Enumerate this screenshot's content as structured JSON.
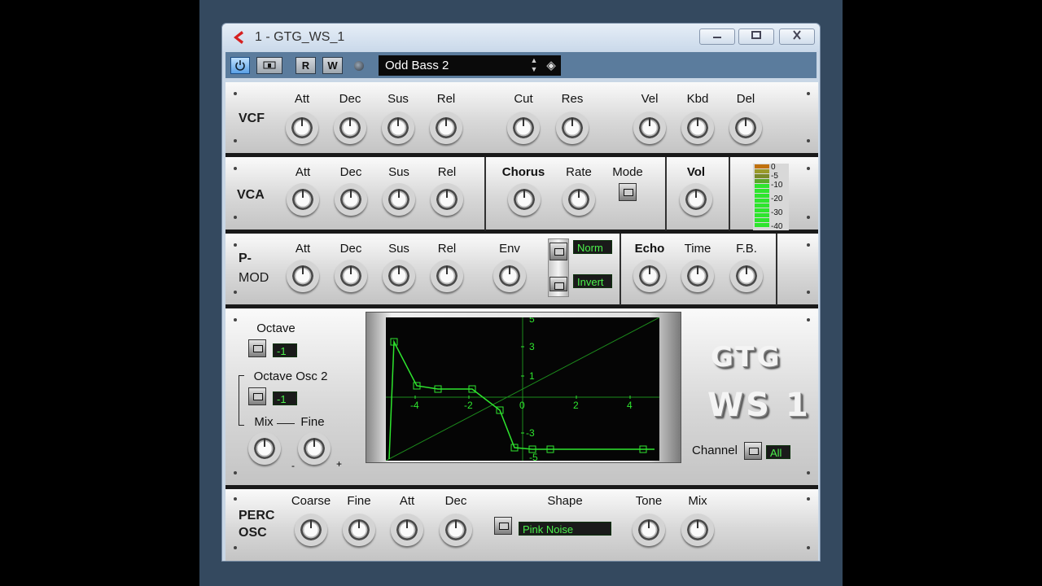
{
  "window": {
    "title": "1 - GTG_WS_1"
  },
  "toolbar": {
    "r_label": "R",
    "w_label": "W",
    "preset": "Odd Bass 2"
  },
  "vcf": {
    "label": "VCF",
    "knobs": [
      "Att",
      "Dec",
      "Sus",
      "Rel",
      "Cut",
      "Res",
      "Vel",
      "Kbd",
      "Del"
    ]
  },
  "vca": {
    "label": "VCA",
    "knobs": [
      "Att",
      "Dec",
      "Sus",
      "Rel"
    ],
    "chorus": "Chorus",
    "rate": "Rate",
    "mode": "Mode",
    "vol": "Vol",
    "meter_ticks": [
      "0",
      "-5",
      "-10",
      "-20",
      "-30",
      "-40"
    ]
  },
  "pmod": {
    "label_line1": "P-",
    "label_line2": "MOD",
    "knobs": [
      "Att",
      "Dec",
      "Sus",
      "Rel",
      "Env"
    ],
    "norm": "Norm",
    "invert": "Invert",
    "echo": "Echo",
    "time": "Time",
    "fb": "F.B."
  },
  "osc": {
    "octave_label": "Octave",
    "octave_value": "-1",
    "octave2_label": "Octave Osc 2",
    "octave2_value": "-1",
    "mix_label": "Mix",
    "fine_label": "Fine",
    "minus": "-",
    "plus": "+"
  },
  "graph": {
    "x_ticks": [
      "-4",
      "-2",
      "0",
      "2",
      "4"
    ],
    "y_ticks": [
      "5",
      "3",
      "1",
      "-3",
      "-5"
    ]
  },
  "logo": {
    "line1": "GTG",
    "line2": "WS 1"
  },
  "channel": {
    "label": "Channel",
    "value": "All"
  },
  "perc": {
    "label_line1": "PERC",
    "label_line2": "OSC",
    "knobs": [
      "Coarse",
      "Fine",
      "Att",
      "Dec"
    ],
    "shape_label": "Shape",
    "shape_value": "Pink Noise",
    "tone": "Tone",
    "mix": "Mix"
  },
  "colors": {
    "display_green": "#4cf24c",
    "toolbar": "#5b7c9d",
    "desktop": "#34495f"
  }
}
